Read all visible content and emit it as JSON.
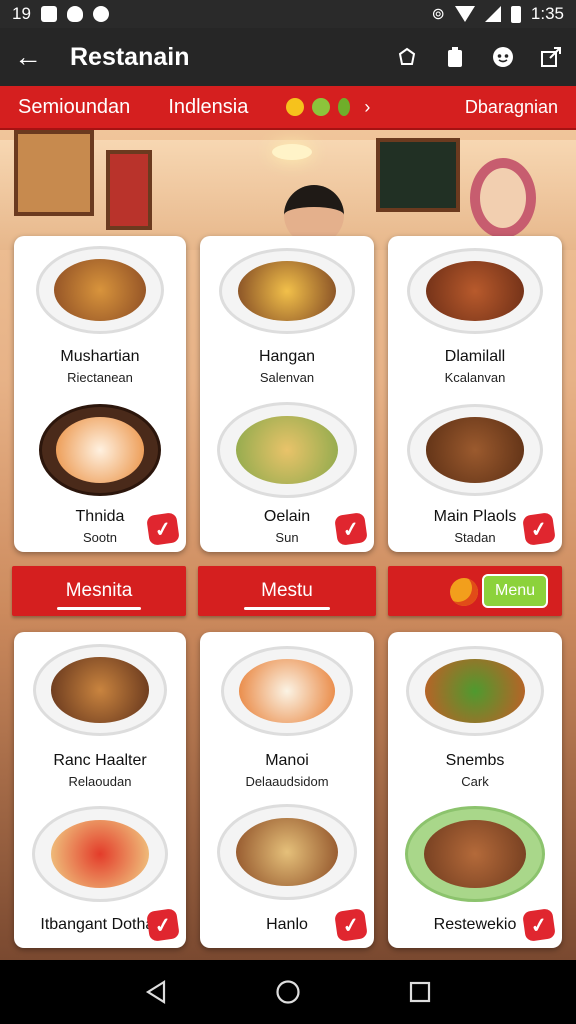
{
  "status_bar": {
    "time_left": "19",
    "time_right": "1:35"
  },
  "app_bar": {
    "title": "Restanain"
  },
  "tabs": {
    "items": [
      {
        "label": "Semioundan"
      },
      {
        "label": "Indlensia"
      }
    ],
    "right_label": "Dbaragnian"
  },
  "top_cards": [
    {
      "name_top": "Mushartian",
      "sub_top": "Riectanean",
      "name_bottom": "Thnida",
      "sub_bottom": "Sootn"
    },
    {
      "name_top": "Hangan",
      "sub_top": "Salenvan",
      "name_bottom": "Oelain",
      "sub_bottom": "Sun"
    },
    {
      "name_top": "Dlamilall",
      "sub_top": "Kcalanvan",
      "name_bottom": "Main Plaols",
      "sub_bottom": "Stadan"
    }
  ],
  "banners": [
    {
      "label": "Mesnita"
    },
    {
      "label": "Mestu"
    }
  ],
  "menu_button": "Menu",
  "bottom_cards": [
    {
      "name_top": "Ranc Haalter",
      "sub_top": "Relaoudan",
      "name_bottom": "Itbangant Dothar"
    },
    {
      "name_top": "Manoi",
      "sub_top": "Delaaudsidom",
      "name_bottom": "Hanlo"
    },
    {
      "name_top": "Snembs",
      "sub_top": "Cark",
      "name_bottom": "Restewekio"
    }
  ],
  "colors": {
    "accent_red": "#d51f1f",
    "menu_green": "#8cd23b",
    "dark_bar": "#262626"
  },
  "icons": [
    "back-arrow-icon",
    "share-icon",
    "clipboard-icon",
    "emoji-icon",
    "export-icon",
    "check-icon",
    "back-triangle-icon",
    "home-circle-icon",
    "recents-square-icon"
  ]
}
